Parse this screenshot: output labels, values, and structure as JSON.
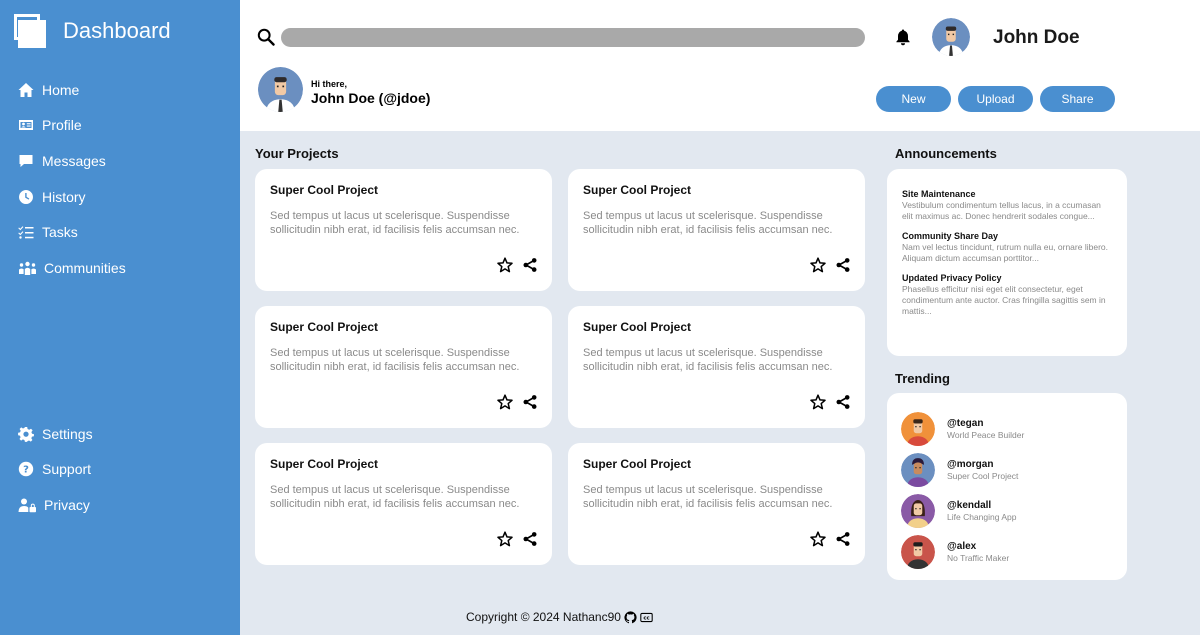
{
  "sidebar": {
    "title": "Dashboard",
    "nav_top": [
      {
        "label": "Home",
        "icon": "home-icon"
      },
      {
        "label": "Profile",
        "icon": "id-card-icon"
      },
      {
        "label": "Messages",
        "icon": "message-icon"
      },
      {
        "label": "History",
        "icon": "clock-icon"
      },
      {
        "label": "Tasks",
        "icon": "checklist-icon"
      },
      {
        "label": "Communities",
        "icon": "people-icon"
      }
    ],
    "nav_bottom": [
      {
        "label": "Settings",
        "icon": "gear-icon"
      },
      {
        "label": "Support",
        "icon": "question-icon"
      },
      {
        "label": "Privacy",
        "icon": "user-lock-icon"
      }
    ]
  },
  "header": {
    "search_placeholder": "",
    "username": "John Doe",
    "greeting_hi": "Hi there,",
    "greeting_name": "John Doe (@jdoe)",
    "actions": {
      "new": "New",
      "upload": "Upload",
      "share": "Share"
    }
  },
  "projects": {
    "title": "Your Projects",
    "items": [
      {
        "title": "Super Cool Project",
        "desc": "Sed tempus ut lacus ut scelerisque. Suspendisse sollicitudin nibh erat, id facilisis felis accumsan nec."
      },
      {
        "title": "Super Cool Project",
        "desc": "Sed tempus ut lacus ut scelerisque. Suspendisse sollicitudin nibh erat, id facilisis felis accumsan nec."
      },
      {
        "title": "Super Cool Project",
        "desc": "Sed tempus ut lacus ut scelerisque. Suspendisse sollicitudin nibh erat, id facilisis felis accumsan nec."
      },
      {
        "title": "Super Cool Project",
        "desc": "Sed tempus ut lacus ut scelerisque. Suspendisse sollicitudin nibh erat, id facilisis felis accumsan nec."
      },
      {
        "title": "Super Cool Project",
        "desc": "Sed tempus ut lacus ut scelerisque. Suspendisse sollicitudin nibh erat, id facilisis felis accumsan nec."
      },
      {
        "title": "Super Cool Project",
        "desc": "Sed tempus ut lacus ut scelerisque. Suspendisse sollicitudin nibh erat, id facilisis felis accumsan nec."
      }
    ]
  },
  "announcements": {
    "title": "Announcements",
    "items": [
      {
        "title": "Site Maintenance",
        "text": "Vestibulum condimentum tellus lacus, in a ccumasan elit maximus ac. Donec hendrerit sodales congue..."
      },
      {
        "title": "Community Share Day",
        "text": "Nam vel lectus tincidunt, rutrum nulla eu, ornare libero. Aliquam dictum accumsan porttitor..."
      },
      {
        "title": "Updated Privacy Policy",
        "text": "Phasellus efficitur nisi eget elit consectetur, eget condimentum ante auctor. Cras fringilla sagittis sem in mattis..."
      }
    ]
  },
  "trending": {
    "title": "Trending",
    "items": [
      {
        "handle": "@tegan",
        "sub": "World Peace Builder",
        "color": "#f0913a"
      },
      {
        "handle": "@morgan",
        "sub": "Super Cool Project",
        "color": "#6b8fc0"
      },
      {
        "handle": "@kendall",
        "sub": "Life Changing App",
        "color": "#8a5aa6"
      },
      {
        "handle": "@alex",
        "sub": "No Traffic Maker",
        "color": "#c9544a"
      }
    ]
  },
  "footer": {
    "text": "Copyright © 2024 Nathanc90"
  },
  "colors": {
    "accent": "#4a8fd0",
    "background": "#e2e8f0",
    "search_bar": "#a9a9a9"
  }
}
